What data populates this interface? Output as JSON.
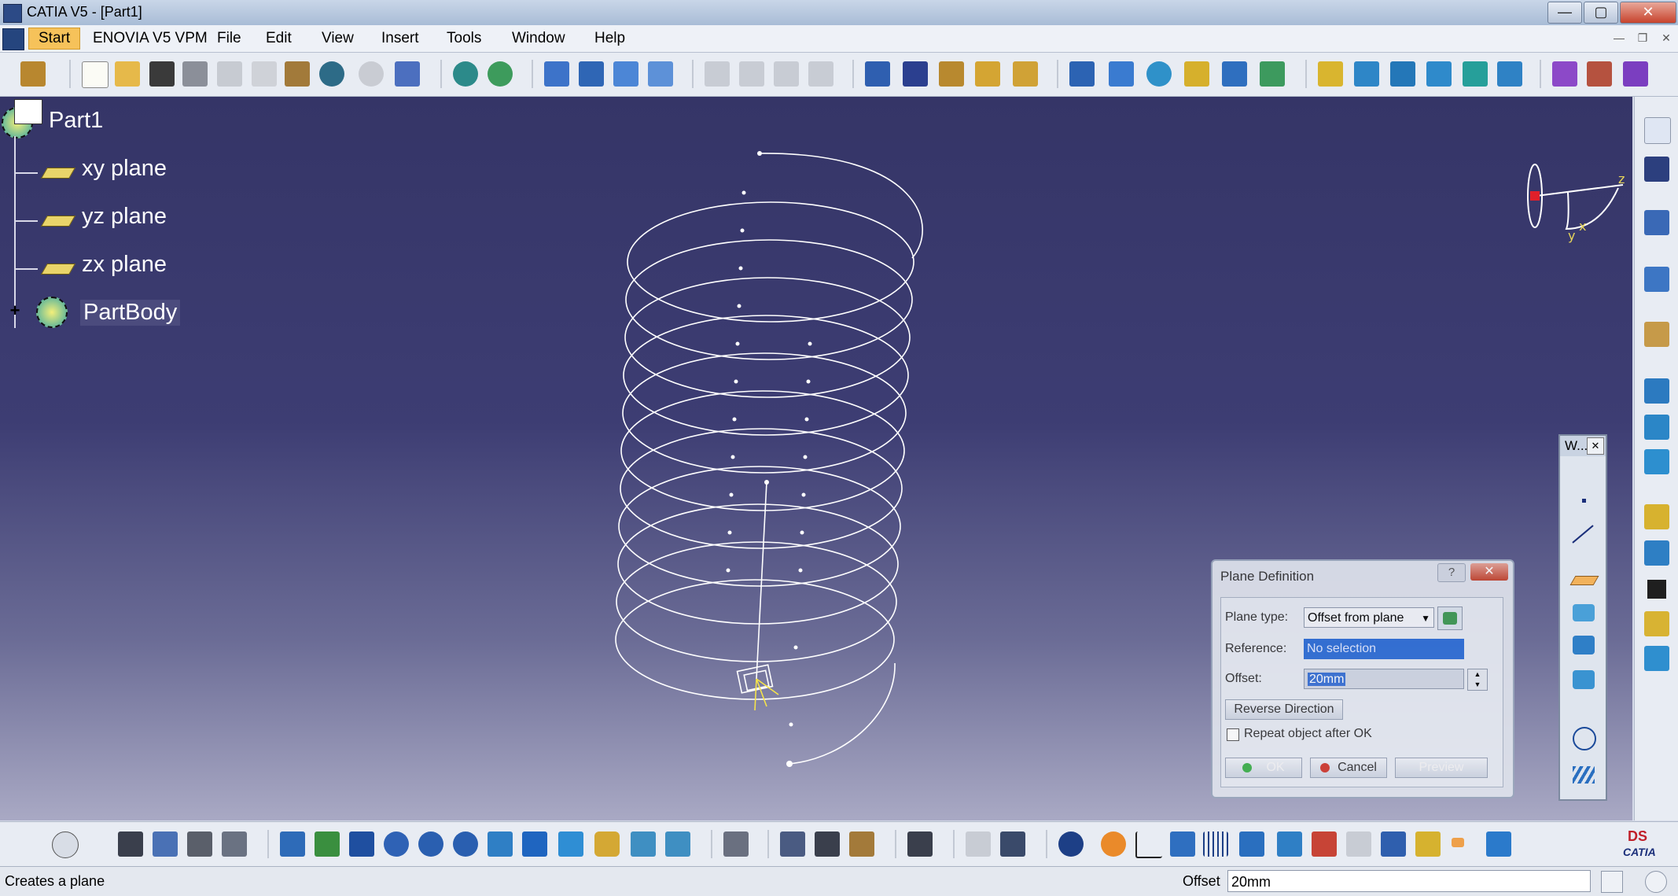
{
  "window": {
    "title": "CATIA V5 - [Part1]",
    "minimize": "—",
    "maximize": "▢",
    "close": "✕"
  },
  "menubar": {
    "items": [
      "Start",
      "ENOVIA V5 VPM",
      "File",
      "Edit",
      "View",
      "Insert",
      "Tools",
      "Window",
      "Help"
    ],
    "mdi_controls": [
      "—",
      "❐",
      "✕"
    ]
  },
  "tree": {
    "root": "Part1",
    "items": [
      "xy plane",
      "yz plane",
      "zx plane"
    ],
    "body": "PartBody"
  },
  "compass": {
    "labels": [
      "z",
      "y",
      "x"
    ]
  },
  "floating_toolbar": {
    "title": "W...",
    "close": "✕"
  },
  "dialog": {
    "title": "Plane Definition",
    "help": "?",
    "close": "✕",
    "plane_type_label": "Plane type:",
    "plane_type_value": "Offset from plane",
    "reference_label": "Reference:",
    "reference_value": "No selection",
    "offset_label": "Offset:",
    "offset_value": "20mm",
    "reverse_button": "Reverse Direction",
    "repeat_label": "Repeat object after OK",
    "ok_button": "OK",
    "cancel_button": "Cancel",
    "preview_button": "Preview"
  },
  "statusbar": {
    "message": "Creates a plane",
    "offset_label": "Offset",
    "offset_value": "20mm"
  },
  "brand": {
    "logo_text": "CATIA"
  },
  "colors": {
    "viewport_top": "#353567",
    "viewport_bottom": "#a9a9c4",
    "accent_start": "#f6c25a",
    "helix": "#ffffff",
    "dialog_close": "#c5442e"
  }
}
